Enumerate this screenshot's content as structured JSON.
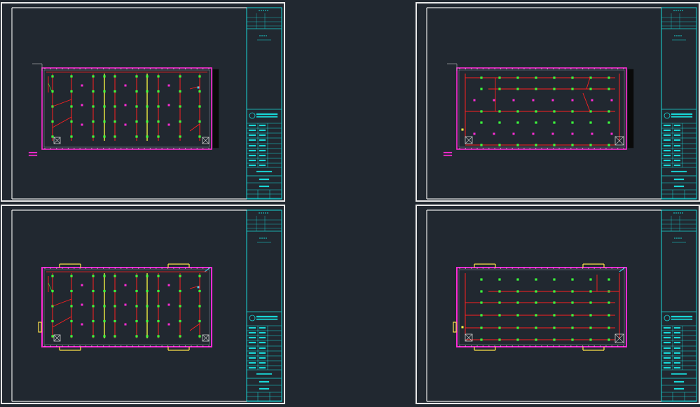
{
  "title": "",
  "colors": {
    "background": "#212830",
    "frame": "#e8e8e8",
    "title_block": "#19d7d7",
    "wall": "#ff2bd6",
    "wire": "#ff2020",
    "fixture": "#3cff3c",
    "yellow_run": "#ffff44",
    "door": "#ffe24a"
  },
  "sheets": [
    {
      "id": "sheet-top-left",
      "layout": "vertical-runs",
      "variant": "floor",
      "labels": true
    },
    {
      "id": "sheet-top-right",
      "layout": "horizontal-runs",
      "variant": "floor",
      "labels": true
    },
    {
      "id": "sheet-bottom-left",
      "layout": "vertical-runs",
      "variant": "roof",
      "labels": false
    },
    {
      "id": "sheet-bottom-right",
      "layout": "horizontal-runs",
      "variant": "roof",
      "labels": false
    }
  ],
  "icons": [
    "fixture-dot-icon",
    "junction-box-icon",
    "panel-box-icon",
    "compass-logo-icon"
  ]
}
